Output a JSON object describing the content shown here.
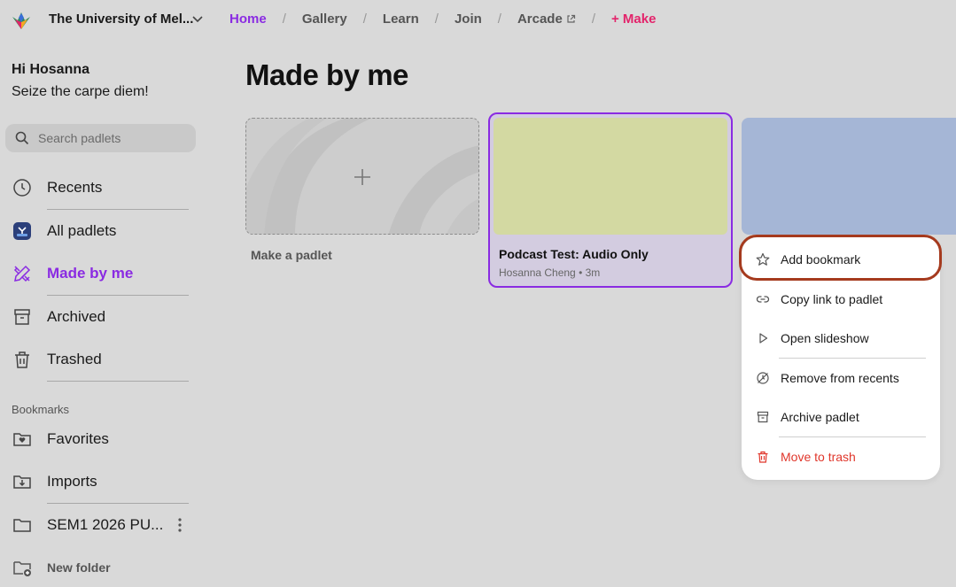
{
  "header": {
    "org_name": "The University of Mel...",
    "nav": [
      {
        "label": "Home"
      },
      {
        "label": "Gallery"
      },
      {
        "label": "Learn"
      },
      {
        "label": "Join"
      },
      {
        "label": "Arcade"
      },
      {
        "label": "+ Make"
      }
    ]
  },
  "sidebar": {
    "greeting": "Hi Hosanna",
    "tagline": "Seize the carpe diem!",
    "search_placeholder": "Search padlets",
    "items": [
      {
        "label": "Recents",
        "icon": "clock-icon"
      },
      {
        "label": "All padlets",
        "icon": "padlet-app-icon"
      },
      {
        "label": "Made by me",
        "icon": "pencil-ruler-icon"
      },
      {
        "label": "Archived",
        "icon": "archive-icon"
      },
      {
        "label": "Trashed",
        "icon": "trash-icon"
      }
    ],
    "bookmarks_label": "Bookmarks",
    "folders": [
      {
        "label": "Favorites",
        "icon": "folder-heart-icon"
      },
      {
        "label": "Imports",
        "icon": "folder-import-icon"
      },
      {
        "label": "SEM1 2026 PU...",
        "icon": "folder-icon"
      }
    ],
    "new_folder_label": "New folder"
  },
  "main": {
    "title": "Made by me",
    "make_card_label": "Make a padlet",
    "padlet": {
      "title": "Podcast Test: Audio Only",
      "author": "Hosanna Cheng",
      "time": "3m"
    }
  },
  "context_menu": {
    "items": [
      {
        "label": "Add bookmark",
        "icon": "star-icon"
      },
      {
        "label": "Copy link to padlet",
        "icon": "link-icon"
      },
      {
        "label": "Open slideshow",
        "icon": "play-icon"
      },
      {
        "label": "Remove from recents",
        "icon": "clock-off-icon"
      },
      {
        "label": "Archive padlet",
        "icon": "archive-icon"
      },
      {
        "label": "Move to trash",
        "icon": "trash-icon"
      }
    ]
  },
  "colors": {
    "accent": "#8a2be2",
    "make": "#e3246b",
    "danger": "#e0362b",
    "highlight_ring": "#a53a1e"
  }
}
